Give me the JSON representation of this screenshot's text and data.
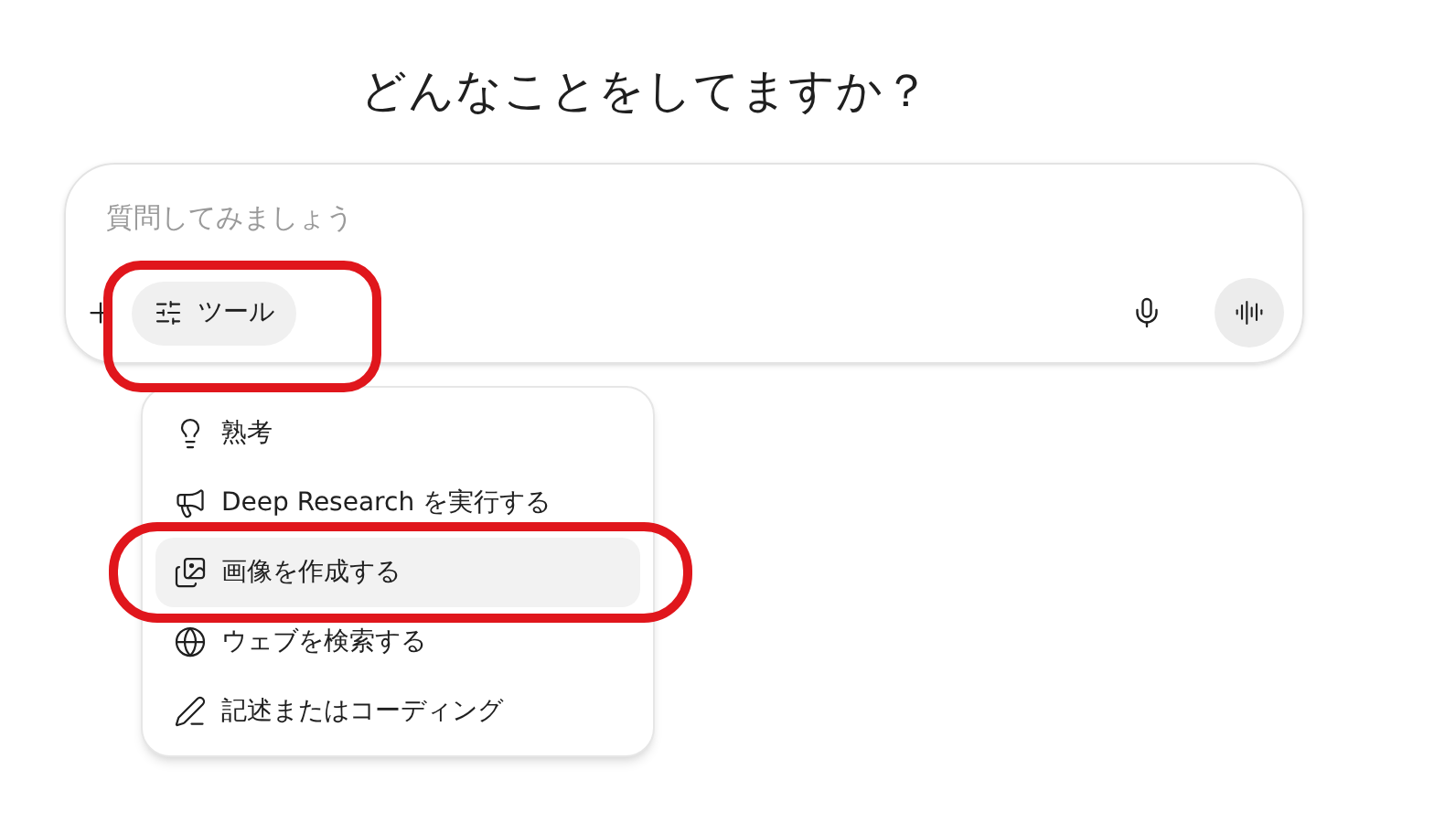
{
  "heading": "どんなことをしてますか？",
  "composer": {
    "placeholder": "質問してみましょう",
    "tools_button": "ツール"
  },
  "tools_menu": [
    {
      "kind": "bulb",
      "label": "熟考",
      "selected": false
    },
    {
      "kind": "megaphone",
      "label": "Deep Research を実行する",
      "selected": false
    },
    {
      "kind": "image",
      "label": "画像を作成する",
      "selected": true
    },
    {
      "kind": "globe",
      "label": "ウェブを検索する",
      "selected": false
    },
    {
      "kind": "pen",
      "label": "記述またはコーディング",
      "selected": false
    }
  ]
}
